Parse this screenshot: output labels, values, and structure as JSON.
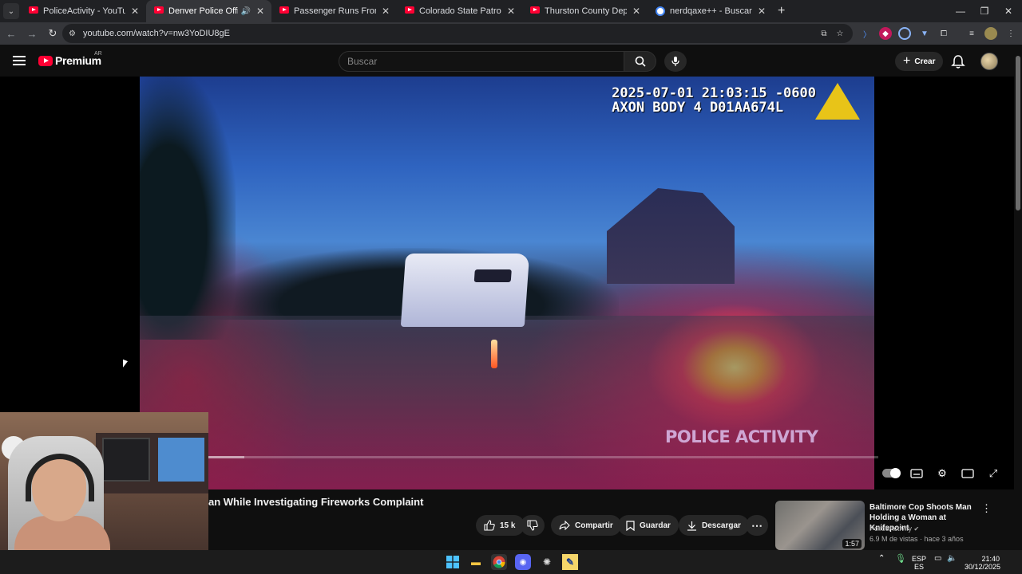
{
  "browser": {
    "tabs": [
      {
        "title": "PoliceActivity - YouTube",
        "active": false
      },
      {
        "title": "Denver Police Officer Shoot",
        "active": true,
        "audio": true
      },
      {
        "title": "Passenger Runs From Traffic St",
        "active": false
      },
      {
        "title": "Colorado State Patrol Uses Grap",
        "active": false
      },
      {
        "title": "Thurston County Deputies Use",
        "active": false
      },
      {
        "title": "nerdqaxe++ - Buscar con Goog",
        "active": false
      }
    ],
    "url": "youtube.com/watch?v=nw3YoDIU8gE"
  },
  "youtube": {
    "logo_text": "Premium",
    "country_code": "AR",
    "search_placeholder": "Buscar",
    "create_label": "Crear"
  },
  "video": {
    "timestamp_line1": "2025-07-01 21:03:15 -0600",
    "timestamp_line2": "AXON BODY 4 D01AA674L",
    "watermark": "POLICE ACTIVITY",
    "progress_buffered": 0.055
  },
  "below_video": {
    "title": "an While Investigating Fireworks Complaint",
    "likes": "15 k",
    "share_label": "Compartir",
    "save_label": "Guardar",
    "download_label": "Descargar"
  },
  "related": {
    "title": "Baltimore Cop Shoots Man Holding a Woman at Knifepoint",
    "channel": "PoliceActivity",
    "meta": "6.9 M de vistas · hace 3 años",
    "duration": "1:57"
  },
  "taskbar": {
    "lang_top": "ESP",
    "lang_bottom": "ES",
    "time": "21:40",
    "date": "30/12/2025"
  }
}
